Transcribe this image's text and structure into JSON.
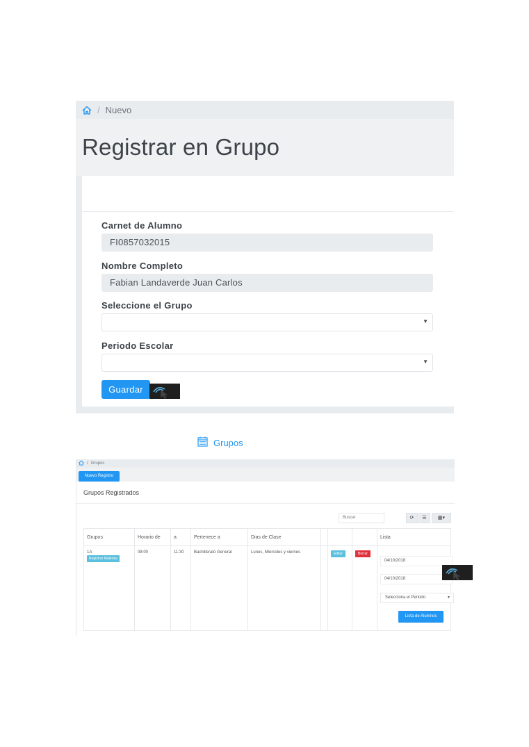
{
  "form_screen": {
    "breadcrumb": {
      "home_icon": "home-icon",
      "current": "Nuevo"
    },
    "page_title": "Registrar en Grupo",
    "fields": {
      "carnet_label": "Carnet de Alumno",
      "carnet_value": "FI0857032015",
      "nombre_label": "Nombre Completo",
      "nombre_value": "Fabian Landaverde Juan Carlos",
      "grupo_label": "Seleccione el Grupo",
      "grupo_value": "",
      "periodo_label": "Periodo Escolar",
      "periodo_value": ""
    },
    "save_button": "Guardar",
    "accent_color": "#2196f3"
  },
  "grupos_caption": {
    "icon": "calendar-icon",
    "text": "Grupos"
  },
  "grupos_screen": {
    "breadcrumb": {
      "home_icon": "home-icon",
      "current": "Grupos"
    },
    "new_button": "Nuevo Registro",
    "card_title": "Grupos Registrados",
    "search_placeholder": "Buscar",
    "toolbar_icons": [
      "refresh-icon",
      "list-view-icon",
      "columns-dropdown-icon"
    ],
    "columns": [
      "Grupos",
      "Horario de",
      "a",
      "Pertenece a",
      "Dias de Clase",
      "",
      "",
      "",
      "Lista"
    ],
    "row": {
      "grupo": "1A",
      "registrar_materias": "Registrar Materias",
      "horario_de": "08:00",
      "horario_a": "11:30",
      "pertenece": "Bachillerato General",
      "dias": "Lunes, Miércoles y viernes",
      "editar": "Editar",
      "borrar": "Borrar",
      "fecha_inicio": "04/10/2018",
      "fecha_fin": "04/10/2018",
      "periodo_placeholder": "Selecciona el Periodo",
      "lista_button": "Lista de Alumnos"
    }
  }
}
